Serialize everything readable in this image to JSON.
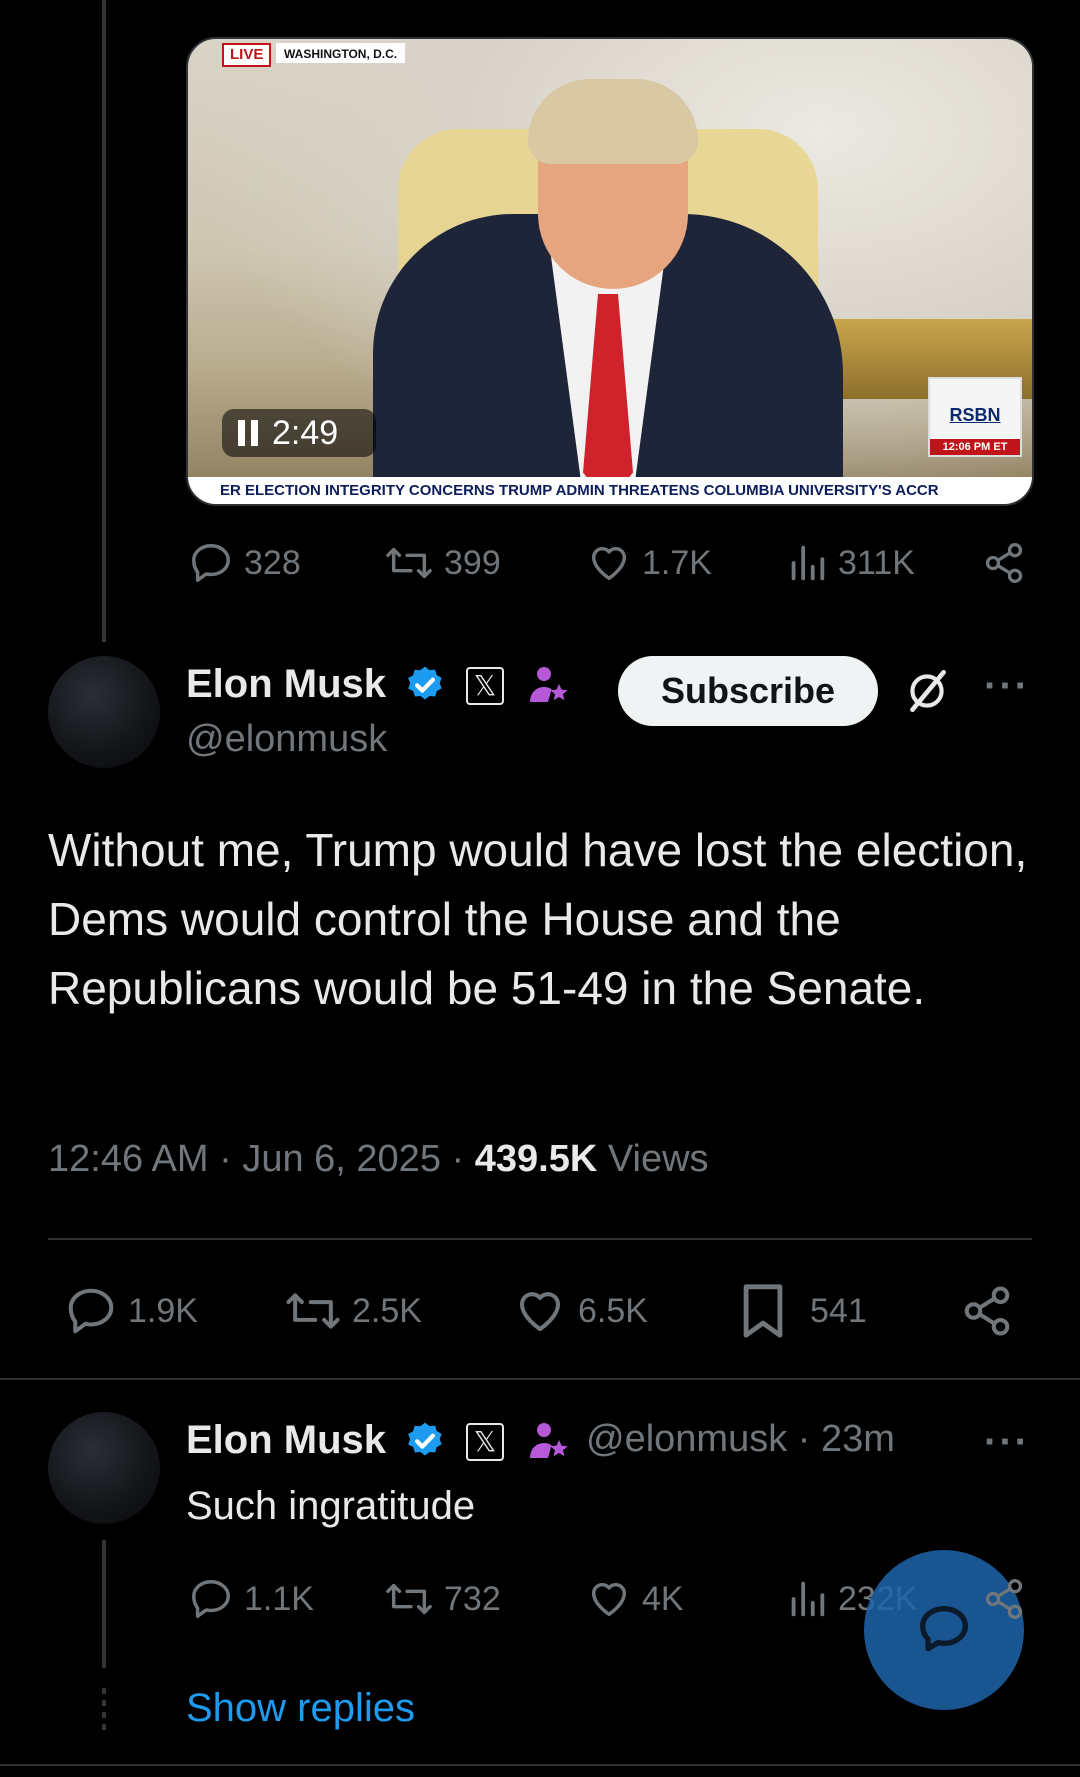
{
  "quoted": {
    "video": {
      "live_label": "LIVE",
      "location_label": "WASHINGTON, D.C.",
      "duration": "2:49",
      "network_logo": "RSBN",
      "network_time": "12:06 PM ET",
      "ticker": "ER ELECTION INTEGRITY CONCERNS    TRUMP ADMIN THREATENS COLUMBIA UNIVERSITY'S ACCR"
    },
    "stats": {
      "replies": "328",
      "reposts": "399",
      "likes": "1.7K",
      "views": "311K"
    }
  },
  "main_tweet": {
    "name": "Elon Musk",
    "handle": "@elonmusk",
    "subscribe_label": "Subscribe",
    "text": "Without me, Trump would have lost the election, Dems would control the House and the Republicans would be 51-49 in the Senate.",
    "time": "12:46 AM",
    "date": "Jun 6, 2025",
    "views_count": "439.5K",
    "views_label": "Views",
    "stats": {
      "replies": "1.9K",
      "reposts": "2.5K",
      "likes": "6.5K",
      "bookmarks": "541"
    }
  },
  "reply": {
    "name": "Elon Musk",
    "handle": "@elonmusk",
    "age": "23m",
    "text": "Such ingratitude",
    "stats": {
      "replies": "1.1K",
      "reposts": "732",
      "likes": "4K",
      "views": "232K"
    },
    "show_replies_label": "Show replies"
  },
  "colors": {
    "accent": "#1d9bf0",
    "verified": "#1d9bf0",
    "muted": "#71767b",
    "background": "#000000",
    "premium": "#b659d8"
  },
  "icons": [
    "reply-icon",
    "repost-icon",
    "like-icon",
    "views-icon",
    "share-icon",
    "bookmark-icon",
    "verified-icon",
    "x-badge-icon",
    "affiliate-icon",
    "grok-icon",
    "more-icon",
    "compose-icon",
    "pause-icon"
  ]
}
